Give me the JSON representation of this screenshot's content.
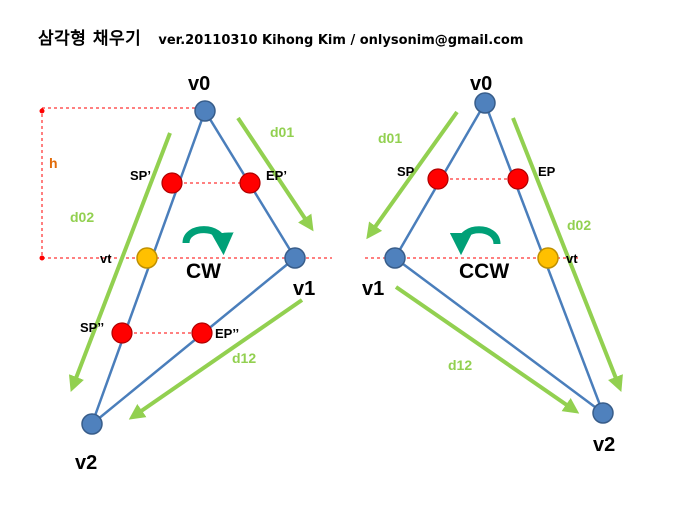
{
  "header": {
    "title": "삼각형 채우기",
    "subtitle": "ver.20110310 Kihong Kim / onlysonim@gmail.com"
  },
  "cw": {
    "direction": "CW",
    "vertices": {
      "v0": "v0",
      "v1": "v1",
      "v2": "v2",
      "vt": "vt"
    },
    "points": {
      "sp1": "SP’",
      "ep1": "EP’",
      "sp2": "SP’’",
      "ep2": "EP’’"
    },
    "vectors": {
      "d01": "d01",
      "d02": "d02",
      "d12": "d12"
    },
    "height": "h"
  },
  "ccw": {
    "direction": "CCW",
    "vertices": {
      "v0": "v0",
      "v1": "v1",
      "v2": "v2",
      "vt": "vt"
    },
    "points": {
      "sp": "SP",
      "ep": "EP"
    },
    "vectors": {
      "d01": "d01",
      "d02": "d02",
      "d12": "d12"
    }
  },
  "colors": {
    "edge": "#4a7ebb",
    "vertex_fill": "#4f81bd",
    "vertex_stroke": "#385d8a",
    "scan_point": "#ff0000",
    "vt_point": "#ffc000",
    "vector_arrow": "#92d050",
    "rotation_arrow": "#00a077",
    "dashed_line": "#ff0000",
    "height_label": "#e26b0a"
  },
  "icons": {
    "cw_rotation": "clockwise-arrow-icon",
    "ccw_rotation": "counterclockwise-arrow-icon"
  }
}
